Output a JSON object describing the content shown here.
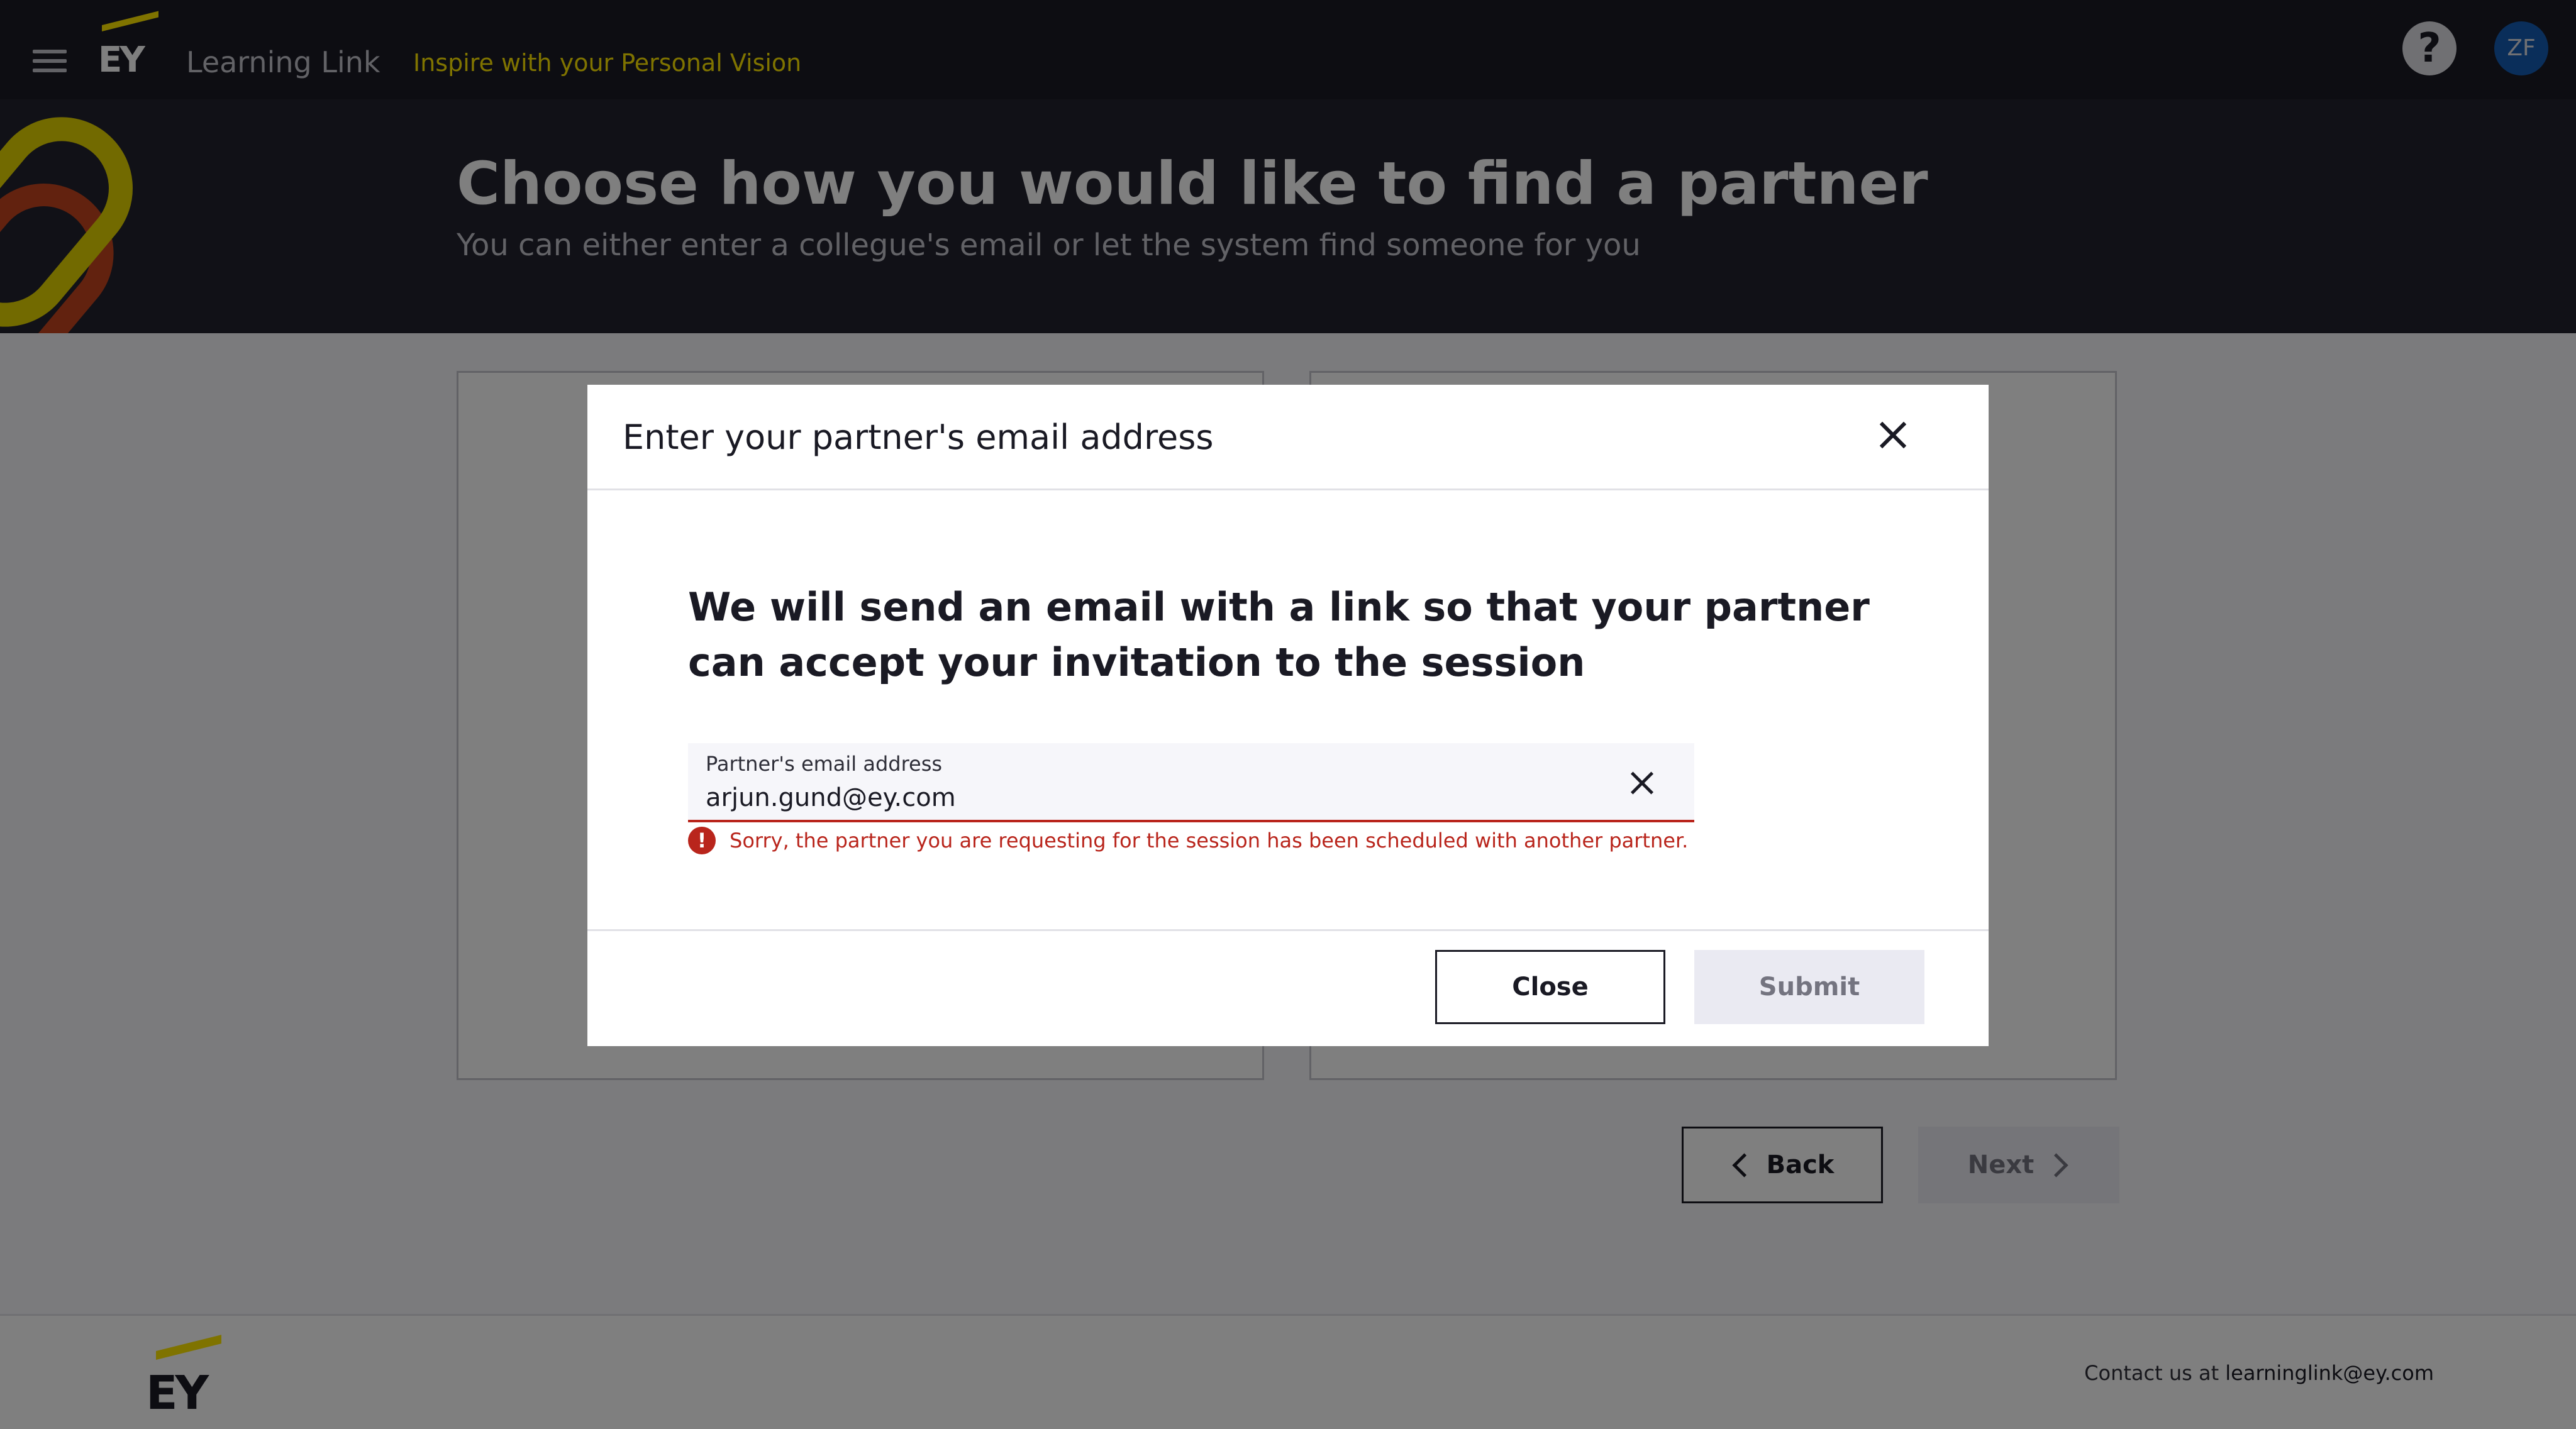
{
  "app": {
    "brand": "EY",
    "name": "Learning Link",
    "tagline": "Inspire with your Personal Vision",
    "help_symbol": "?",
    "user_initials": "ZF"
  },
  "hero": {
    "title": "Choose how you would like to find a partner",
    "subtitle": "You can either enter a collegue's email or let the system find someone for you"
  },
  "navigation": {
    "back_label": "Back",
    "next_label": "Next"
  },
  "footer": {
    "brand": "EY",
    "contact_prefix": "Contact us at",
    "contact_email": "learninglink@ey.com"
  },
  "modal": {
    "title": "Enter your partner's email address",
    "heading": "We will send an email with a link so that your partner can accept your invitation to the session",
    "field": {
      "label": "Partner's email address",
      "value": "arjun.gund@ey.com"
    },
    "error_symbol": "!",
    "error": "Sorry, the partner you are requesting for the session has been scheduled with another partner.",
    "close_label": "Close",
    "submit_label": "Submit"
  },
  "colors": {
    "brand_yellow": "#ffe600",
    "header_bg": "#1a1a24",
    "error_red": "#b9251c",
    "avatar_blue": "#155cb4",
    "disabled_bg": "#eaeaf2"
  },
  "icons": [
    "menu-icon",
    "help-icon",
    "chevron-left-icon",
    "chevron-right-icon",
    "close-icon",
    "clear-icon",
    "error-icon"
  ]
}
